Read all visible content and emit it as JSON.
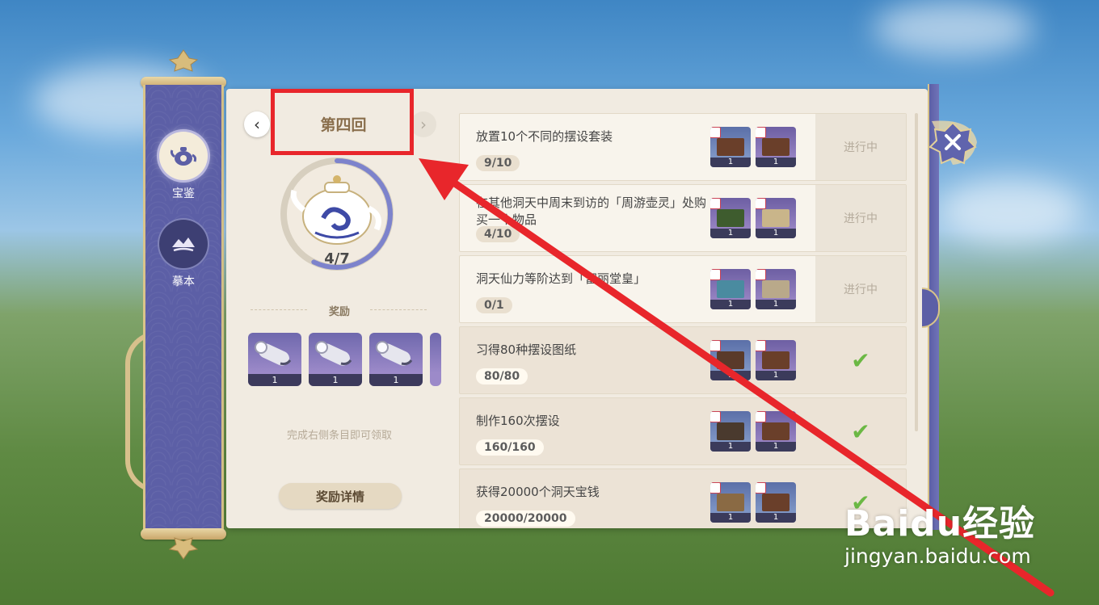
{
  "sidebar": {
    "tabs": [
      {
        "label": "宝鉴",
        "icon": "teapot-icon",
        "active": true
      },
      {
        "label": "摹本",
        "icon": "mountain-cloud-icon",
        "active": false
      }
    ]
  },
  "round": {
    "title": "第四回",
    "progress_text": "4/7",
    "progress": {
      "done": 4,
      "total": 7
    }
  },
  "rewards": {
    "label": "奖励",
    "items": [
      {
        "icon": "scroll-blueprint-icon",
        "count": "1"
      },
      {
        "icon": "scroll-blueprint-icon",
        "count": "1"
      },
      {
        "icon": "scroll-blueprint-icon",
        "count": "1"
      }
    ],
    "hint": "完成右侧条目即可领取",
    "detail_button": "奖励详情"
  },
  "tasks": [
    {
      "title": "放置10个不同的摆设套装",
      "progress": "9/10",
      "status": "进行中",
      "done": false,
      "thumbs": [
        {
          "count": "1"
        },
        {
          "count": "1"
        }
      ]
    },
    {
      "title": "在其他洞天中周末到访的「周游壶灵」处购买一个物品",
      "progress": "4/10",
      "status": "进行中",
      "done": false,
      "thumbs": [
        {
          "count": "1"
        },
        {
          "count": "1"
        }
      ]
    },
    {
      "title": "洞天仙力等阶达到「富丽堂皇」",
      "progress": "0/1",
      "status": "进行中",
      "done": false,
      "thumbs": [
        {
          "count": "1"
        },
        {
          "count": "1"
        }
      ]
    },
    {
      "title": "习得80种摆设图纸",
      "progress": "80/80",
      "status": "✔",
      "done": true,
      "thumbs": [
        {
          "count": "1"
        },
        {
          "count": "1"
        }
      ]
    },
    {
      "title": "制作160次摆设",
      "progress": "160/160",
      "status": "✔",
      "done": true,
      "thumbs": [
        {
          "count": "1"
        },
        {
          "count": "1"
        }
      ]
    },
    {
      "title": "获得20000个洞天宝钱",
      "progress": "20000/20000",
      "status": "✔",
      "done": true,
      "thumbs": [
        {
          "count": "1"
        },
        {
          "count": "1"
        }
      ]
    }
  ],
  "watermark": {
    "logo": "Baidu经验",
    "url": "jingyan.baidu.com"
  },
  "colors": {
    "accent_red": "#e8262b",
    "sidebar_purple": "#5c5fa6",
    "complete_green": "#6bb844"
  }
}
